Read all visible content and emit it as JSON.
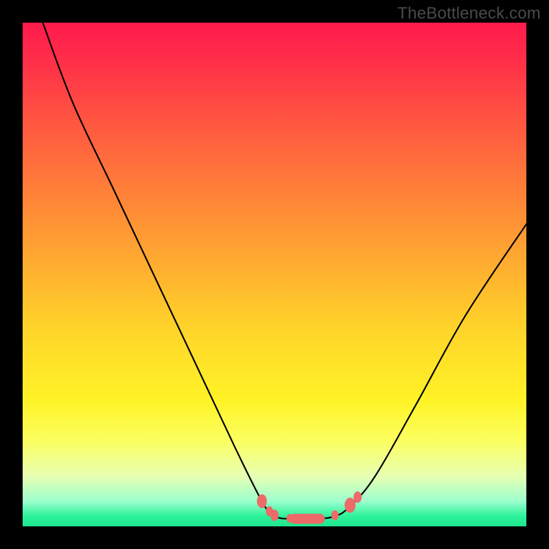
{
  "watermark": "TheBottleneck.com",
  "chart_data": {
    "type": "line",
    "title": "",
    "xlabel": "",
    "ylabel": "",
    "xlim": [
      0,
      100
    ],
    "ylim": [
      0,
      100
    ],
    "grid": false,
    "legend": false,
    "annotations": [],
    "series": [
      {
        "name": "curve",
        "x": [
          4,
          10,
          18,
          26,
          34,
          42,
          47.5,
          50,
          54,
          58,
          62,
          65,
          70,
          78,
          88,
          100
        ],
        "values": [
          100,
          84,
          67,
          50,
          33,
          16,
          5,
          2,
          1.5,
          1.5,
          2,
          4,
          10,
          24,
          42,
          60
        ]
      }
    ],
    "markers": [
      {
        "x": 47.5,
        "y": 5.0,
        "size": 2.2
      },
      {
        "x": 49.0,
        "y": 3.0,
        "size": 1.6
      },
      {
        "x": 50.0,
        "y": 2.2,
        "size": 1.8
      },
      {
        "x": 53.0,
        "y": 1.6,
        "size": 1.4
      },
      {
        "x": 56.0,
        "y": 1.5,
        "size": 1.4
      },
      {
        "x": 59.0,
        "y": 1.6,
        "size": 1.4
      },
      {
        "x": 62.0,
        "y": 2.2,
        "size": 1.6
      },
      {
        "x": 65.0,
        "y": 4.2,
        "size": 2.4
      },
      {
        "x": 66.5,
        "y": 5.8,
        "size": 1.8
      }
    ],
    "flat_bar": {
      "x_start": 53,
      "x_end": 60,
      "y": 1.5,
      "thickness": 2.0
    },
    "gradient_stops": [
      {
        "pos": 0,
        "color": "#ff1a4d"
      },
      {
        "pos": 22,
        "color": "#ff5d3f"
      },
      {
        "pos": 60,
        "color": "#ffd22a"
      },
      {
        "pos": 83,
        "color": "#fbff60"
      },
      {
        "pos": 98,
        "color": "#2cf29a"
      }
    ]
  }
}
